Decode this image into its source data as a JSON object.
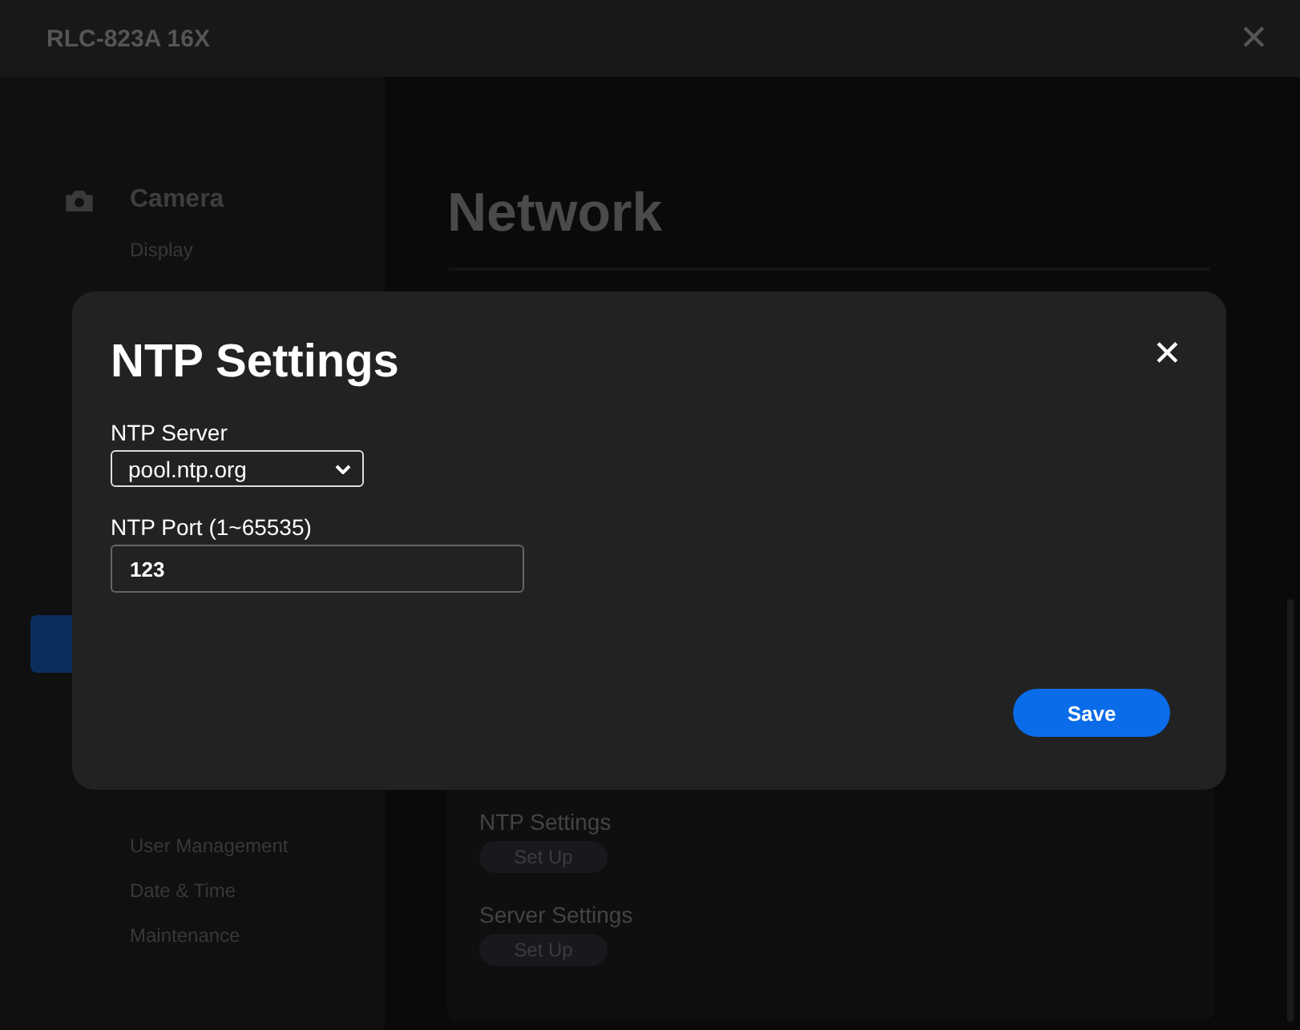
{
  "window": {
    "title": "RLC-823A 16X",
    "close": "✕"
  },
  "sidebar": {
    "section": {
      "label": "Camera"
    },
    "items": [
      {
        "label": "Display",
        "selected": false
      },
      {
        "selected": true
      },
      {
        "label": "User Management",
        "selected": false
      },
      {
        "label": "Date & Time",
        "selected": false
      },
      {
        "label": "Maintenance",
        "selected": false
      }
    ]
  },
  "main": {
    "heading": "Network",
    "settings": [
      {
        "label": "NTP Settings",
        "button": "Set Up"
      },
      {
        "label": "Server Settings",
        "button": "Set Up"
      }
    ]
  },
  "dialog": {
    "title": "NTP Settings",
    "close": "✕",
    "fields": [
      {
        "kind": "select",
        "label": "NTP Server",
        "value": "pool.ntp.org"
      },
      {
        "kind": "text",
        "label": "NTP Port (1~65535)",
        "value": "123"
      }
    ],
    "button": "Save"
  }
}
